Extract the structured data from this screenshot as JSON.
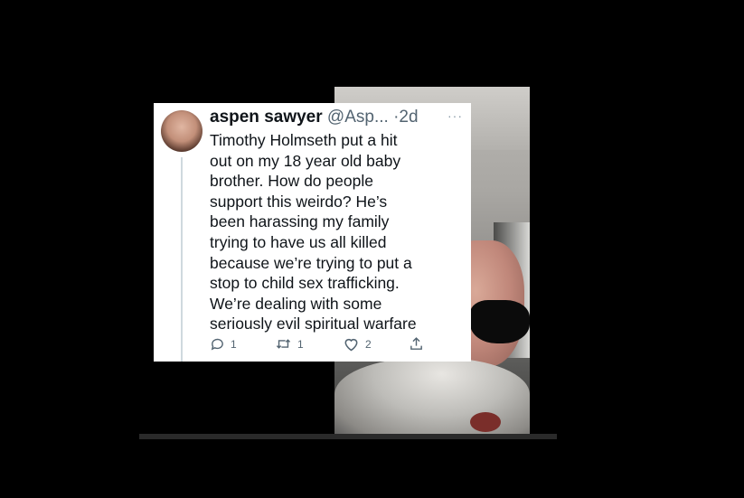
{
  "tweet": {
    "display_name": "aspen sawyer",
    "handle": "@Asp...",
    "separator": "·",
    "time": "2d",
    "more": "···",
    "text": "Timothy Holmseth put a hit\nout on my 18 year old baby\nbrother. How do people\nsupport this weirdo? He’s\nbeen harassing my family\ntrying to have us all killed\nbecause we’re trying to put a\nstop to child sex trafficking.\nWe’re dealing with some\nseriously evil spiritual warfare",
    "actions": {
      "reply_count": "1",
      "retweet_count": "1",
      "like_count": "2"
    }
  },
  "icons": {
    "reply": "reply-icon",
    "retweet": "retweet-icon",
    "like": "heart-icon",
    "share": "share-icon",
    "more": "more-icon"
  },
  "colors": {
    "background": "#000000",
    "card": "#ffffff",
    "text": "#0f1419",
    "secondary": "#536471"
  }
}
